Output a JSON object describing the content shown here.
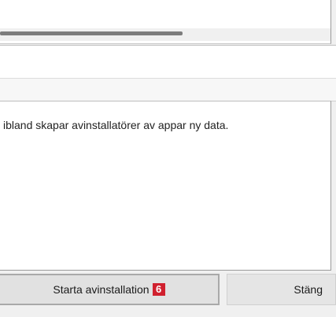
{
  "message": {
    "text": "ibland skapar avinstallatörer av appar ny data."
  },
  "buttons": {
    "start_label": "Starta avinstallation",
    "start_badge": "6",
    "close_label": "Stäng"
  },
  "colors": {
    "badge": "#d0202e",
    "background": "#f0f0f0",
    "panel": "#ffffff"
  }
}
